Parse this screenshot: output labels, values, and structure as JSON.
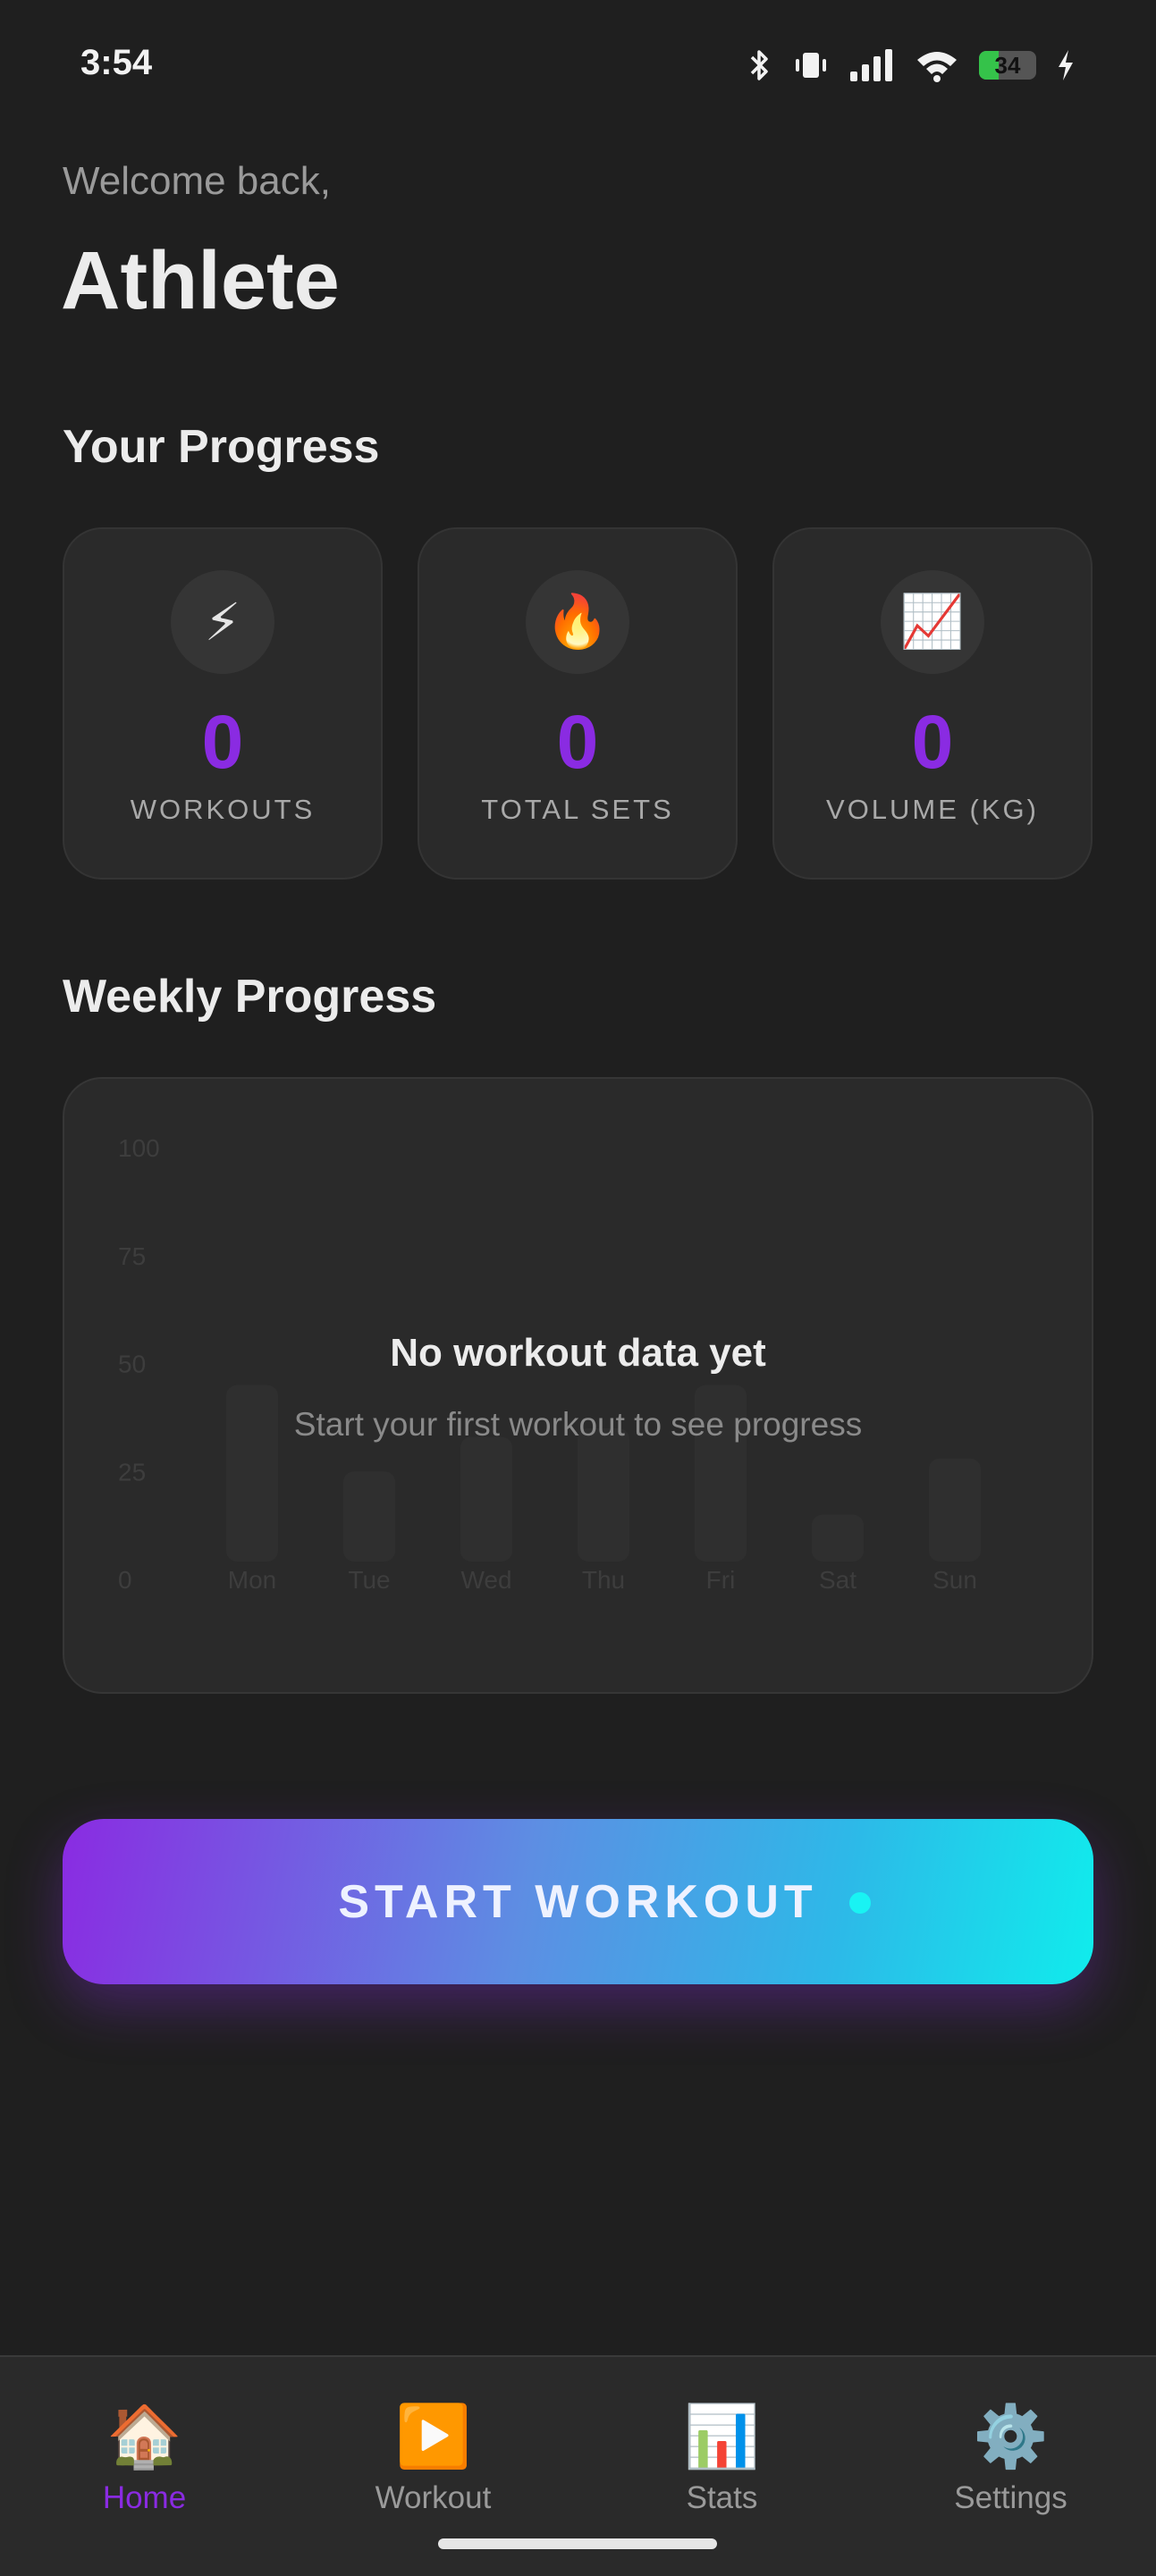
{
  "status_bar": {
    "time": "3:54",
    "battery": "34",
    "battery_level": 0.34,
    "icons": [
      "bluetooth-icon",
      "vibrate-icon",
      "signal-icon",
      "wifi-icon",
      "battery-icon",
      "charging-icon"
    ]
  },
  "welcome": {
    "subtitle": "Welcome back,",
    "name": "Athlete"
  },
  "progress": {
    "title": "Your Progress",
    "stats": [
      {
        "icon": "⚡",
        "icon_name": "lightning-icon",
        "value": "0",
        "label": "WORKOUTS"
      },
      {
        "icon": "🔥",
        "icon_name": "fire-icon",
        "value": "0",
        "label": "TOTAL SETS"
      },
      {
        "icon": "📈",
        "icon_name": "chart-increasing-icon",
        "value": "0",
        "label": "VOLUME (KG)"
      }
    ]
  },
  "weekly": {
    "title": "Weekly Progress",
    "empty_title": "No workout data yet",
    "empty_subtitle": "Start your first workout to see progress"
  },
  "chart_data": {
    "type": "bar",
    "categories": [
      "Mon",
      "Tue",
      "Wed",
      "Thu",
      "Fri",
      "Sat",
      "Sun"
    ],
    "values": [
      45,
      25,
      33,
      35,
      45,
      15,
      28
    ],
    "y_ticks": [
      "100",
      "75",
      "50",
      "25",
      "0"
    ],
    "ylim": [
      0,
      100
    ],
    "placeholder": true
  },
  "start_button": {
    "label": "START WORKOUT"
  },
  "nav": {
    "items": [
      {
        "icon": "🏠",
        "icon_name": "home-icon",
        "label": "Home",
        "active": true
      },
      {
        "icon": "▶️",
        "icon_name": "play-icon",
        "label": "Workout",
        "active": false
      },
      {
        "icon": "📊",
        "icon_name": "bar-chart-icon",
        "label": "Stats",
        "active": false
      },
      {
        "icon": "⚙️",
        "icon_name": "gear-icon",
        "label": "Settings",
        "active": false
      }
    ]
  },
  "colors": {
    "background": "#1f1f1f",
    "card": "#2a2a2a",
    "accent": "#8a2be2",
    "gradient_end": "#10ecec"
  }
}
